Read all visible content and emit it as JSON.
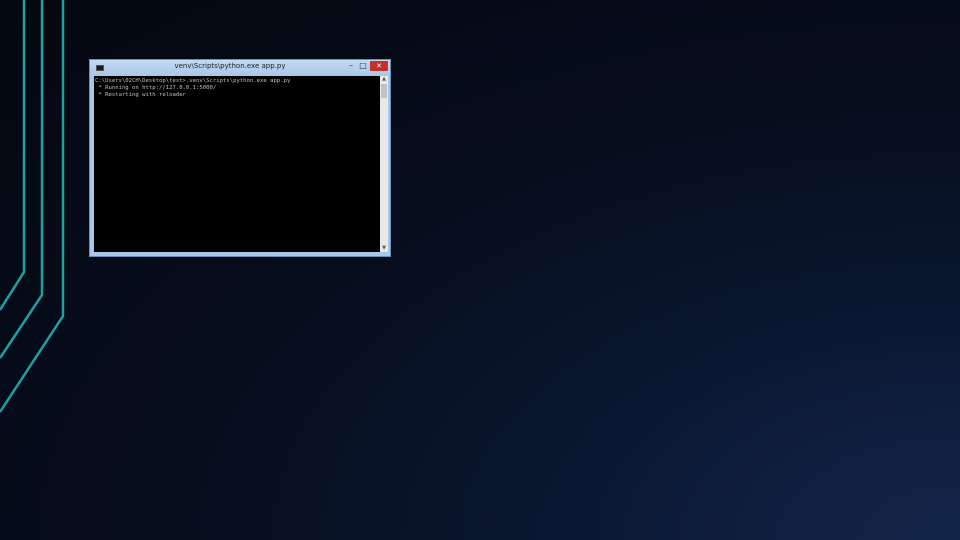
{
  "window": {
    "title": "venv\\Scripts\\python.exe  app.py",
    "minimize_glyph": "–",
    "maximize_glyph": "□",
    "close_glyph": "✕"
  },
  "console": {
    "lines": [
      "C:\\Users\\02CH\\Desktop\\test>.venv\\Scripts\\python.exe app.py",
      " * Running on http://127.0.0.1:5000/",
      " * Restarting with reloader"
    ]
  },
  "scrollbar": {
    "up_glyph": "▲",
    "down_glyph": "▼"
  },
  "colors": {
    "accent_lines": "#1fa0a0",
    "console_background": "#000000",
    "console_text": "#c0c0c0",
    "window_frame": "#a9c8e8",
    "close_button": "#c7302a"
  }
}
